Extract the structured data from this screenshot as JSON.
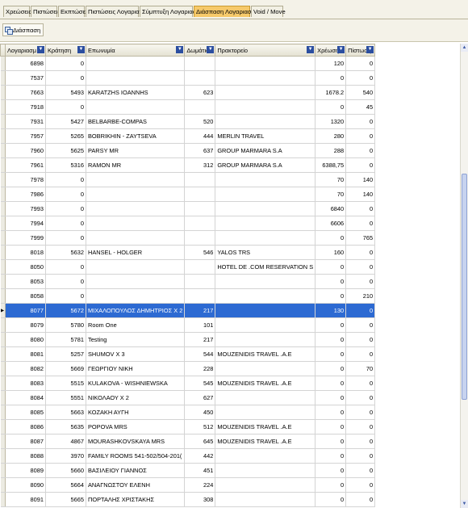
{
  "tabs": [
    "Χρεώσεις",
    "Πιστώσεις",
    "Εκπτώσεις",
    "Πιστώσεις Λογαριασμών",
    "Σύμπτυξη Λογαριασμών",
    "Διάσπαση Λογαριασμών",
    "Void / Move"
  ],
  "active_tab": "Διάσπαση Λογαριασμών",
  "toolbar": {
    "split_button": "Διάσπαση"
  },
  "columns": [
    "Λογαριασμ",
    "Κράτηση",
    "Επωνυμία",
    "Δωμάτιο",
    "Πρακτορείο",
    "Χρέωση",
    "Πίστωση"
  ],
  "selected_account": "8077",
  "rows": [
    [
      "6898",
      "0",
      "",
      "",
      "",
      "120",
      "0"
    ],
    [
      "7537",
      "0",
      "",
      "",
      "",
      "0",
      "0"
    ],
    [
      "7663",
      "5493",
      "KARATZHS IOANNHS",
      "623",
      "",
      "1678.2",
      "540"
    ],
    [
      "7918",
      "0",
      "",
      "",
      "",
      "0",
      "45"
    ],
    [
      "7931",
      "5427",
      "BELBARBE-COMPAS",
      "520",
      "",
      "1320",
      "0"
    ],
    [
      "7957",
      "5265",
      "BOBRIKHIN - ZAYTSEVA",
      "444",
      "MERLIN TRAVEL",
      "280",
      "0"
    ],
    [
      "7960",
      "5625",
      "PARSY MR",
      "637",
      "GROUP MARMARA S.A",
      "288",
      "0"
    ],
    [
      "7961",
      "5316",
      "RAMON MR",
      "312",
      "GROUP MARMARA S.A",
      "6388,75",
      "0"
    ],
    [
      "7978",
      "0",
      "",
      "",
      "",
      "70",
      "140"
    ],
    [
      "7986",
      "0",
      "",
      "",
      "",
      "70",
      "140"
    ],
    [
      "7993",
      "0",
      "",
      "",
      "",
      "6840",
      "0"
    ],
    [
      "7994",
      "0",
      "",
      "",
      "",
      "6606",
      "0"
    ],
    [
      "7999",
      "0",
      "",
      "",
      "",
      "0",
      "765"
    ],
    [
      "8018",
      "5632",
      "HANSEL - HOLGER",
      "546",
      "YALOS TRS",
      "160",
      "0"
    ],
    [
      "8050",
      "0",
      "",
      "",
      "HOTEL DE .COM RESERVATION S",
      "0",
      "0"
    ],
    [
      "8053",
      "0",
      "",
      "",
      "",
      "0",
      "0"
    ],
    [
      "8058",
      "0",
      "",
      "",
      "",
      "0",
      "210"
    ],
    [
      "8077",
      "5672",
      "ΜΙΧΑΛΟΠΟΥΛΟΣ ΔΗΜΗΤΡΙΟΣ Χ 2",
      "217",
      "",
      "130",
      "0"
    ],
    [
      "8079",
      "5780",
      "Room One",
      "101",
      "",
      "0",
      "0"
    ],
    [
      "8080",
      "5781",
      "Testing",
      "217",
      "",
      "0",
      "0"
    ],
    [
      "8081",
      "5257",
      "SHUMOV X 3",
      "544",
      "MOUZENIDIS TRAVEL .A.E",
      "0",
      "0"
    ],
    [
      "8082",
      "5669",
      "ΓΕΩΡΓΙΟΥ ΝΙΚΗ",
      "228",
      "",
      "0",
      "70"
    ],
    [
      "8083",
      "5515",
      "KULAKOVA - WISHNIEWSKA",
      "545",
      "MOUZENIDIS TRAVEL .A.E",
      "0",
      "0"
    ],
    [
      "8084",
      "5551",
      "ΝΙΚΟΛΑΟΥ Χ 2",
      "627",
      "",
      "0",
      "0"
    ],
    [
      "8085",
      "5663",
      "ΚΟΖΑΚΗ ΑΥΓΗ",
      "450",
      "",
      "0",
      "0"
    ],
    [
      "8086",
      "5635",
      "POPOVA MRS",
      "512",
      "MOUZENIDIS TRAVEL .A.E",
      "0",
      "0"
    ],
    [
      "8087",
      "4867",
      "MOURASHKOVSKAYA MRS",
      "645",
      "MOUZENIDIS TRAVEL .A.E",
      "0",
      "0"
    ],
    [
      "8088",
      "3970",
      "FAMILY ROOMS 541-502/504-201(",
      "442",
      "",
      "0",
      "0"
    ],
    [
      "8089",
      "5660",
      "ΒΑΣΙΛΕΙΟΥ ΓΙΑΝΝΟΣ",
      "451",
      "",
      "0",
      "0"
    ],
    [
      "8090",
      "5664",
      "ΑΝΑΓΝΩΣΤΟΥ ΕΛΕΝΗ",
      "224",
      "",
      "0",
      "0"
    ],
    [
      "8091",
      "5665",
      "ΠΟΡΤΑΛΗΣ ΧΡΙΣΤΑΚΗΣ",
      "308",
      "",
      "0",
      "0"
    ]
  ],
  "colors": {
    "selection": "#2d6ad2",
    "active_tab": "#f6c96a"
  },
  "scrollbar": {
    "thumb_position": 0.55
  }
}
